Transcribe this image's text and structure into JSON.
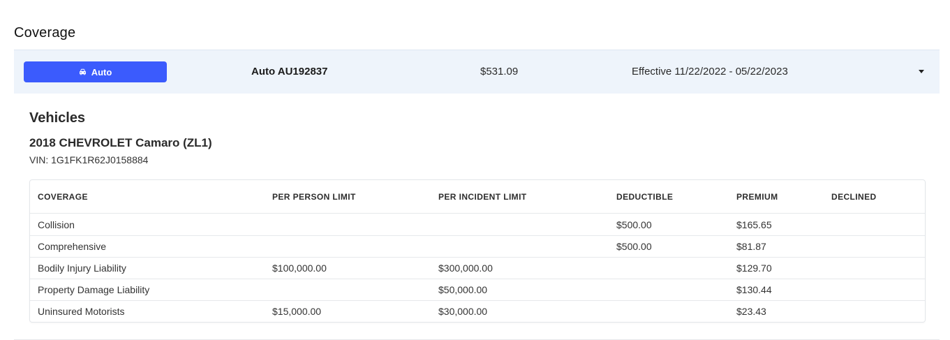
{
  "section_title": "Coverage",
  "policy": {
    "type_label": "Auto",
    "type_icon": "car-icon",
    "accent_color": "#3b5bfd",
    "name": "Auto AU192837",
    "amount": "$531.09",
    "effective": "Effective 11/22/2022 - 05/22/2023"
  },
  "vehicles": {
    "heading": "Vehicles",
    "vehicle_name": "2018 CHEVROLET Camaro (ZL1)",
    "vin": "VIN: 1G1FK1R62J0158884"
  },
  "table": {
    "columns": [
      "COVERAGE",
      "PER PERSON LIMIT",
      "PER INCIDENT LIMIT",
      "DEDUCTIBLE",
      "PREMIUM",
      "DECLINED"
    ],
    "rows": [
      [
        "Collision",
        "",
        "",
        "$500.00",
        "$165.65",
        ""
      ],
      [
        "Comprehensive",
        "",
        "",
        "$500.00",
        "$81.87",
        ""
      ],
      [
        "Bodily Injury Liability",
        "$100,000.00",
        "$300,000.00",
        "",
        "$129.70",
        ""
      ],
      [
        "Property Damage Liability",
        "",
        "$50,000.00",
        "",
        "$130.44",
        ""
      ],
      [
        "Uninsured Motorists",
        "$15,000.00",
        "$30,000.00",
        "",
        "$23.43",
        ""
      ]
    ]
  }
}
